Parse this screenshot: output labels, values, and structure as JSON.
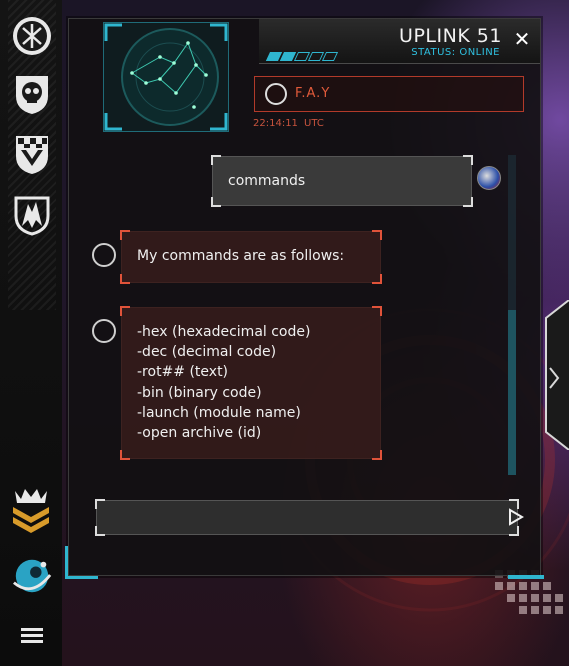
{
  "window": {
    "title": "UPLINK 51",
    "status": "STATUS: ONLINE",
    "close_icon": "close-icon"
  },
  "contact": {
    "name": "F.A.Y",
    "time": "22:14:11",
    "timezone": "UTC"
  },
  "progress": {
    "filled_segments": 2,
    "total_segments": 5
  },
  "sidebar": {
    "items": [
      {
        "name": "arrows-emblem-icon"
      },
      {
        "name": "skull-emblem-icon"
      },
      {
        "name": "checker-chevron-emblem-icon"
      },
      {
        "name": "wolf-emblem-icon"
      }
    ],
    "bottom_items": [
      {
        "name": "rank-chevrons-icon"
      },
      {
        "name": "planet-orbit-icon"
      },
      {
        "name": "menu-icon"
      }
    ]
  },
  "chat": {
    "user_message": "commands",
    "bot_intro": "My commands are as follows:",
    "commands": [
      "-hex (hexadecimal code)",
      "-dec (decimal code)",
      "-rot## (text)",
      "-bin (binary code)",
      "-launch (module name)",
      "-open archive (id)"
    ]
  },
  "input": {
    "value": "",
    "placeholder": ""
  },
  "colors": {
    "accent_cyan": "#2fb6cf",
    "accent_red": "#e0533a",
    "panel_dark": "#121012"
  }
}
